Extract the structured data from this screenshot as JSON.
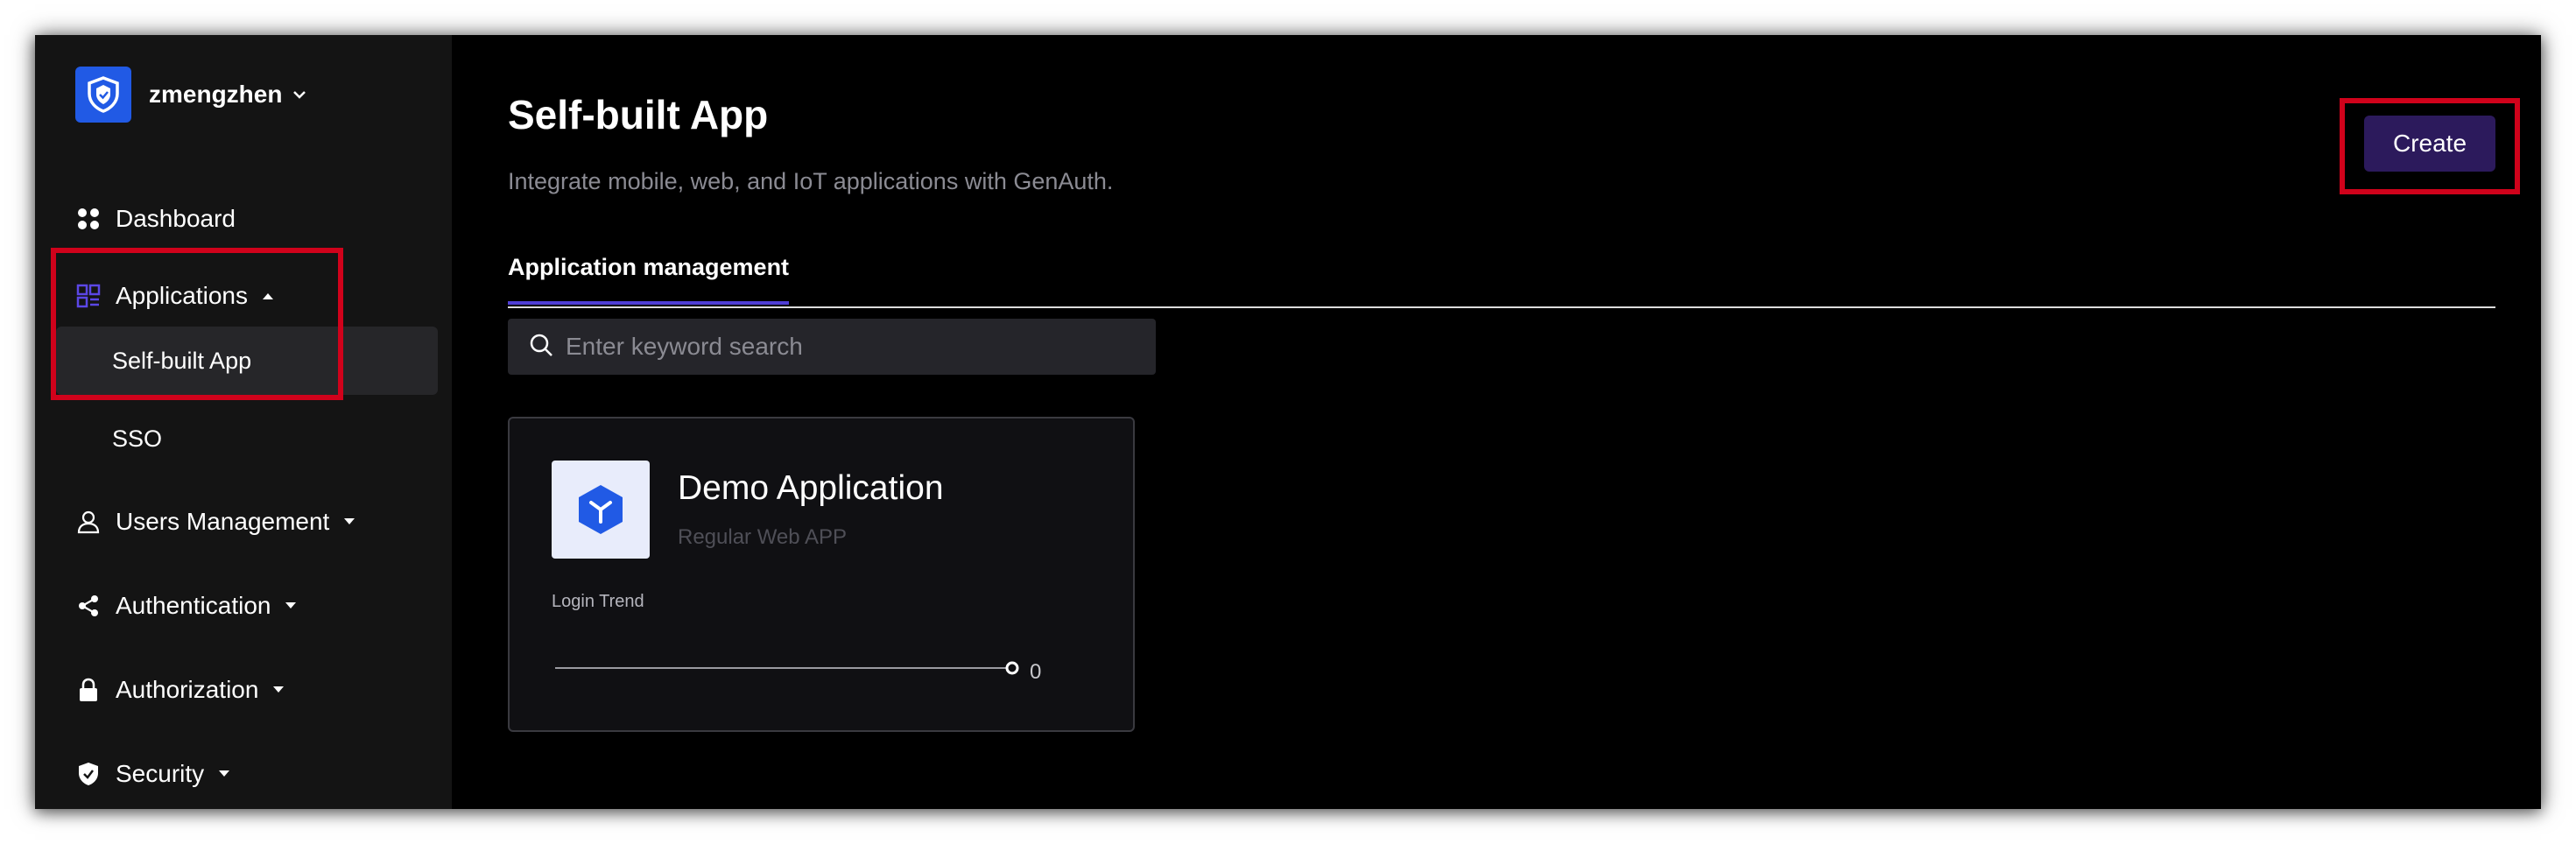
{
  "sidebar": {
    "org_name": "zmengzhen",
    "logo_icon": "shield-icon",
    "items": [
      {
        "label": "Dashboard",
        "icon": "dashboard-grid-icon"
      },
      {
        "label": "Applications",
        "icon": "apps-icon",
        "expanded": true
      },
      {
        "label": "Users Management",
        "icon": "user-icon"
      },
      {
        "label": "Authentication",
        "icon": "share-icon"
      },
      {
        "label": "Authorization",
        "icon": "lock-icon"
      },
      {
        "label": "Security",
        "icon": "shield-check-icon"
      }
    ],
    "sub_items": [
      {
        "label": "Self-built App",
        "active": true
      },
      {
        "label": "SSO"
      }
    ]
  },
  "main": {
    "title": "Self-built App",
    "subtitle": "Integrate mobile, web, and IoT applications with GenAuth.",
    "create_label": "Create",
    "tabs": [
      {
        "label": "Application management",
        "active": true
      }
    ],
    "search": {
      "placeholder": "Enter keyword search",
      "value": ""
    },
    "apps": [
      {
        "name": "Demo Application",
        "type": "Regular Web APP",
        "trend_label": "Login Trend",
        "trend_value": "0"
      }
    ]
  },
  "colors": {
    "accent": "#4f3ed6",
    "create_button": "#2c1a5c",
    "logo": "#215ae5",
    "highlight": "#d0021b"
  }
}
